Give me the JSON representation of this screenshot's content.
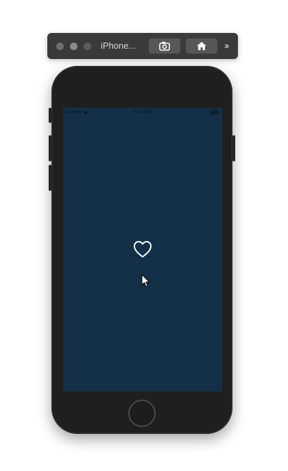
{
  "toolbar": {
    "title": "iPhone...",
    "screenshot_icon": "camera-icon",
    "home_icon": "home-icon",
    "more": "››"
  },
  "device": {
    "status_bar": {
      "carrier": "Carrier",
      "time": "3:42 AM"
    },
    "screen_background": "#133048",
    "content_icon": "heart-outline-icon"
  },
  "colors": {
    "screen": "#133048",
    "toolbar": "#3a3a3c",
    "phone_body": "#1f1f1f"
  }
}
